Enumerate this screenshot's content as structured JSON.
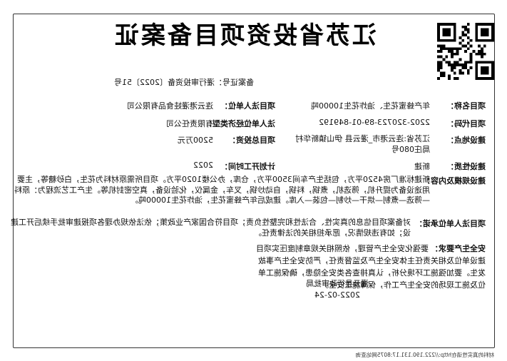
{
  "header": {
    "title": "江苏省投资项目备案证",
    "cert_no": "备案证号：灌行审投资备〔2022〕51号"
  },
  "fields": {
    "project_name_label": "项目名称：",
    "project_name": "年产蜂蜜花生、油炸花生10000吨",
    "legal_entity_label": "项目法人单位：",
    "legal_entity": "连云港灌娃食品有限公司",
    "project_code_label": "项目代码：",
    "project_code": "2202-320723-89-01-849192",
    "entity_type_label": "法人单位经济类型：",
    "entity_type": "有限责任公司",
    "location_label": "建设地点：",
    "location": "江苏省:连云港市_灌云县 伊山镇新华村局庄080号",
    "investment_label": "项目总投资：",
    "investment": "5200万元",
    "nature_label": "建设性质：",
    "nature": "新建",
    "start_time_label": "计划开工时间：",
    "start_time": "2022",
    "scope_label": "建设规模及内容：",
    "scope": "新建标准厂房4520平方，包括生产车间3500平方，仓库，办公楼1020平方。项目所需原材料为花生，白砂糖等，主要用途设备为提升机，筛选机，煮锅，料锅，自动炒锅，叉车，金属仪，化验设备，真空密封机等。生产工艺流程为：原料—筛选—煮制—烘干—炒制—包装—入库。建成后年产蜂蜜花生，油炸花生10000吨。",
    "commitment_label": "项目法人单位承诺：",
    "commitment": "对备案项目信息的真实性、合法性和完整性负责；项目符合国家产业政策；依法依规办理各项报建审批手续后开工建设；如有违规情况，愿承担相关的法律责任。",
    "safety_label": "安全生产要求：",
    "safety": "要强化安全生产管理，依照相关规章制度压实项目建设单位及相关责任主体安全生产及监督责任，严防安全生产事故发生。要加强施工环境分析，认真排查各类安全隐患，确保施工单位及施工现场的安全生产工作，保障施工安全。"
  },
  "approver": {
    "name": "灌云县行政审批局",
    "date": "2022-02-24"
  },
  "footer": "材料的真实性请在http://222.190.131.17:8075网站查询"
}
